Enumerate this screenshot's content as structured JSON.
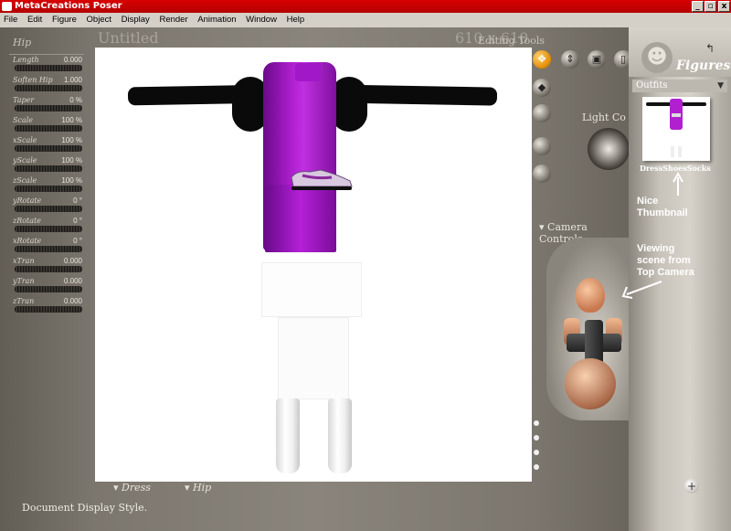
{
  "window": {
    "title": "MetaCreations Poser",
    "minimize": "_",
    "restore": "▫",
    "close": "x"
  },
  "menu": [
    "File",
    "Edit",
    "Figure",
    "Object",
    "Display",
    "Render",
    "Animation",
    "Window",
    "Help"
  ],
  "document": {
    "title": "Untitled",
    "size": "610 x 610",
    "editing_tools": "Editing Tools",
    "display_style_label": "Document Display Style.",
    "figure_menu": "Dress",
    "part_menu": "Hip"
  },
  "params": {
    "heading": "Hip",
    "items": [
      {
        "name": "Length",
        "value": "0.000"
      },
      {
        "name": "Soften Hip",
        "value": "1.000"
      },
      {
        "name": "Taper",
        "value": "0 %"
      },
      {
        "name": "Scale",
        "value": "100 %"
      },
      {
        "name": "xScale",
        "value": "100 %"
      },
      {
        "name": "yScale",
        "value": "100 %"
      },
      {
        "name": "zScale",
        "value": "100 %"
      },
      {
        "name": "yRotate",
        "value": "0 °"
      },
      {
        "name": "zRotate",
        "value": "0 °"
      },
      {
        "name": "xRotate",
        "value": "0 °"
      },
      {
        "name": "xTran",
        "value": "0.000"
      },
      {
        "name": "yTran",
        "value": "0.000"
      },
      {
        "name": "zTran",
        "value": "0.000"
      }
    ]
  },
  "controls": {
    "light": "Light Co",
    "camera": "Camera Controls"
  },
  "library": {
    "title": "Figures",
    "category": "Outfits",
    "item_label": "DressShoesSocks"
  },
  "annotations": {
    "thumbnail": "Nice\nThumbnail",
    "camera": "Viewing\nscene from\nTop Camera"
  },
  "colors": {
    "titlebar": "#c00000",
    "dress": "#b020d0",
    "workspace": "#7b766e"
  }
}
